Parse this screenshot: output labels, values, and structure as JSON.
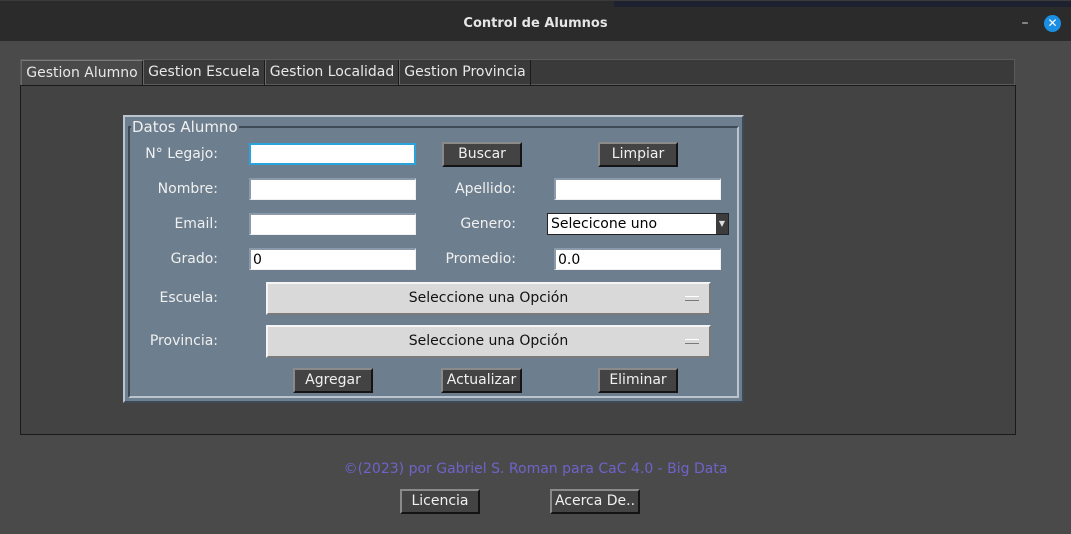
{
  "window": {
    "title": "Control de Alumnos",
    "minimize_glyph": "–",
    "close_glyph": "✕"
  },
  "tabs": [
    {
      "label": "Gestion Alumno",
      "active": true
    },
    {
      "label": "Gestion Escuela",
      "active": false
    },
    {
      "label": "Gestion Localidad",
      "active": false
    },
    {
      "label": "Gestion Provincia",
      "active": false
    }
  ],
  "form": {
    "legend": "Datos Alumno",
    "legajo_label": "N° Legajo:",
    "legajo_value": "",
    "nombre_label": "Nombre:",
    "nombre_value": "",
    "apellido_label": "Apellido:",
    "apellido_value": "",
    "email_label": "Email:",
    "email_value": "",
    "genero_label": "Genero:",
    "genero_value": "Selecicone uno",
    "grado_label": "Grado:",
    "grado_value": "0",
    "promedio_label": "Promedio:",
    "promedio_value": "0.0",
    "escuela_label": "Escuela:",
    "escuela_value": "Seleccione una Opción",
    "provincia_label": "Provincia:",
    "provincia_value": "Seleccione una Opción"
  },
  "buttons": {
    "buscar": "Buscar",
    "limpiar": "Limpiar",
    "agregar": "Agregar",
    "actualizar": "Actualizar",
    "eliminar": "Eliminar",
    "licencia": "Licencia",
    "acerca": "Acerca De.."
  },
  "footer": {
    "credit": "©(2023) por Gabriel S. Roman para CaC 4.0 - Big Data"
  },
  "colors": {
    "frame_bg": "#6d7e8e",
    "panel_bg": "#434343",
    "credit_text": "#6e63c9",
    "focus_border": "#2aa3dc",
    "close_button": "#1a8fe3"
  }
}
